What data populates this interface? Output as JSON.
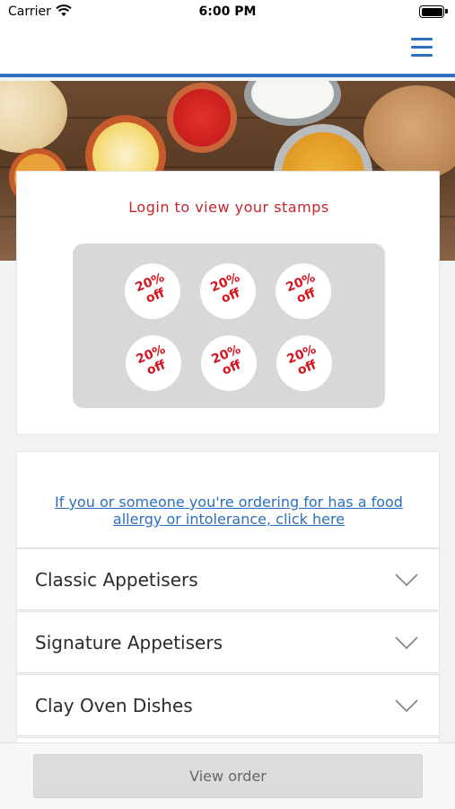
{
  "status_bar": {
    "carrier": "Carrier",
    "time": "6:00 PM"
  },
  "header": {
    "menu_icon": "hamburger-menu-icon",
    "accent_color": "#2c6fc0"
  },
  "stamps": {
    "title": "Login to view your stamps",
    "items": [
      {
        "line1": "20%",
        "line2": "off"
      },
      {
        "line1": "20%",
        "line2": "off"
      },
      {
        "line1": "20%",
        "line2": "off"
      },
      {
        "line1": "20%",
        "line2": "off"
      },
      {
        "line1": "20%",
        "line2": "off"
      },
      {
        "line1": "20%",
        "line2": "off"
      }
    ],
    "accent_color": "#c8252c"
  },
  "allergy": {
    "link_text": "If you or someone you're ordering for has a food allergy or intolerance, click here"
  },
  "menu": {
    "categories": [
      {
        "label": "Classic Appetisers"
      },
      {
        "label": "Signature Appetisers"
      },
      {
        "label": "Clay Oven Dishes"
      }
    ]
  },
  "footer": {
    "view_order_label": "View order"
  }
}
